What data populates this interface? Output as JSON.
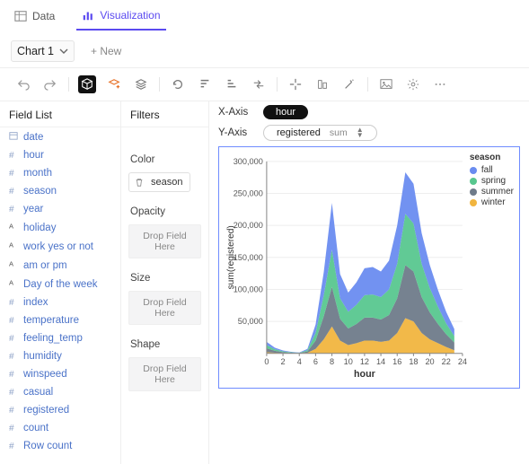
{
  "top_tabs": {
    "data": "Data",
    "viz": "Visualization"
  },
  "chart_tabs": {
    "current": "Chart 1",
    "new": "+ New"
  },
  "toolbar_icons": [
    "undo",
    "redo",
    "cube",
    "layer-add",
    "layers",
    "refresh",
    "sort-desc",
    "sort-asc",
    "transpose",
    "crosshair",
    "stack",
    "wand",
    "image",
    "gear"
  ],
  "field_list": {
    "title": "Field List",
    "items": [
      {
        "type": "date",
        "label": "date"
      },
      {
        "type": "hash",
        "label": "hour"
      },
      {
        "type": "hash",
        "label": "month"
      },
      {
        "type": "hash",
        "label": "season"
      },
      {
        "type": "hash",
        "label": "year"
      },
      {
        "type": "text",
        "label": "holiday"
      },
      {
        "type": "text",
        "label": "work yes or not"
      },
      {
        "type": "text",
        "label": "am or pm"
      },
      {
        "type": "text",
        "label": "Day of the week"
      },
      {
        "type": "hash",
        "label": "index"
      },
      {
        "type": "hash",
        "label": "temperature"
      },
      {
        "type": "hash",
        "label": "feeling_temp"
      },
      {
        "type": "hash",
        "label": "humidity"
      },
      {
        "type": "hash",
        "label": "winspeed"
      },
      {
        "type": "hash",
        "label": "casual"
      },
      {
        "type": "hash",
        "label": "registered"
      },
      {
        "type": "hash",
        "label": "count"
      },
      {
        "type": "hash",
        "label": "Row count"
      }
    ]
  },
  "shelves": {
    "filters": {
      "title": "Filters"
    },
    "color": {
      "title": "Color",
      "chip": "season"
    },
    "opacity": {
      "title": "Opacity",
      "placeholder": "Drop Field Here"
    },
    "size": {
      "title": "Size",
      "placeholder": "Drop Field Here"
    },
    "shape": {
      "title": "Shape",
      "placeholder": "Drop Field Here"
    }
  },
  "axes": {
    "x": {
      "label": "X-Axis",
      "value": "hour"
    },
    "y": {
      "label": "Y-Axis",
      "value": "registered",
      "agg": "sum"
    }
  },
  "legend": {
    "title": "season",
    "items": [
      "fall",
      "spring",
      "summer",
      "winter"
    ]
  },
  "colors": {
    "fall": "#6a8cf0",
    "spring": "#58c78f",
    "summer": "#6f7b8a",
    "winter": "#f1b53f"
  },
  "chart_data": {
    "type": "area",
    "title": "",
    "xlabel": "hour",
    "ylabel": "sum(registered)",
    "x": [
      0,
      1,
      2,
      3,
      4,
      5,
      6,
      7,
      8,
      9,
      10,
      11,
      12,
      13,
      14,
      15,
      16,
      17,
      18,
      19,
      20,
      21,
      22,
      23
    ],
    "xlim": [
      0,
      24
    ],
    "ylim": [
      0,
      300000
    ],
    "yticks": [
      50000,
      100000,
      150000,
      200000,
      250000,
      300000
    ],
    "xticks": [
      0,
      2,
      4,
      6,
      8,
      10,
      12,
      14,
      16,
      18,
      20,
      22,
      24
    ],
    "stack": true,
    "series": [
      {
        "name": "winter",
        "color": "#f1b53f",
        "values": [
          2000,
          1000,
          500,
          300,
          200,
          1000,
          7000,
          22000,
          42000,
          20000,
          13000,
          16000,
          20000,
          20000,
          18000,
          20000,
          32000,
          55000,
          50000,
          32000,
          22000,
          16000,
          10000,
          5000
        ]
      },
      {
        "name": "summer",
        "color": "#6f7b8a",
        "values": [
          6000,
          3000,
          1500,
          800,
          500,
          2000,
          13000,
          36000,
          62000,
          34000,
          26000,
          30000,
          36000,
          36000,
          35000,
          40000,
          54000,
          83000,
          78000,
          56000,
          42000,
          30000,
          20000,
          12000
        ]
      },
      {
        "name": "spring",
        "color": "#58c78f",
        "values": [
          5000,
          2500,
          1200,
          700,
          400,
          2000,
          12000,
          33000,
          58000,
          32000,
          26000,
          30000,
          35000,
          36000,
          35000,
          40000,
          54000,
          80000,
          75000,
          52000,
          38000,
          27000,
          17000,
          10000
        ]
      },
      {
        "name": "fall",
        "color": "#6a8cf0",
        "values": [
          5000,
          2500,
          1300,
          700,
          400,
          2000,
          13000,
          36000,
          73000,
          38000,
          30000,
          35000,
          42000,
          43000,
          40000,
          45000,
          60000,
          65000,
          62000,
          48000,
          36000,
          26000,
          18000,
          11000
        ]
      }
    ]
  }
}
